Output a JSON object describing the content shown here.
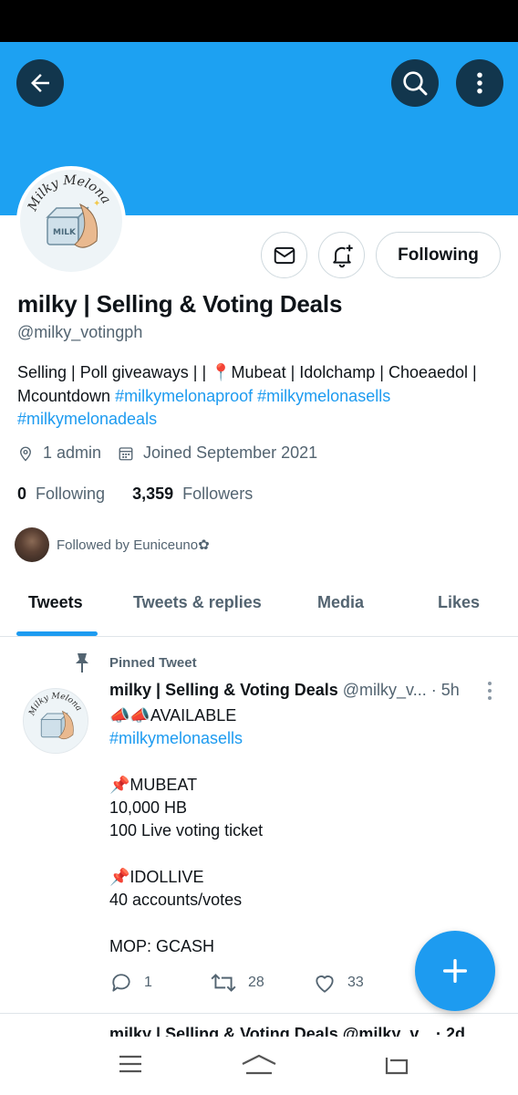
{
  "header": {
    "back_icon": "arrow-left-icon",
    "search_icon": "search-icon",
    "more_icon": "more-vertical-icon",
    "banner_color": "#1da1f2"
  },
  "profile": {
    "avatar_text": "Milky Melona",
    "avatar_sub": "MILK",
    "name": "milky | Selling & Voting Deals",
    "handle": "@milky_votingph",
    "bio_text": "Selling | Poll giveaways | | 📍Mubeat | Idolchamp | Choeaedol | Mcountdown ",
    "bio_tags": [
      "#milkymelonaproof",
      "#milkymelonasells",
      "#milkymelonadeals"
    ],
    "location": "1 admin",
    "joined": "Joined September 2021",
    "following_count": "0",
    "following_label": "Following",
    "followers_count": "3,359",
    "followers_label": "Followers",
    "followed_by": "Followed by Euniceuno✿"
  },
  "actions": {
    "following_button": "Following",
    "mail_icon": "mail-icon",
    "bell_icon": "bell-plus-icon"
  },
  "tabs": [
    {
      "label": "Tweets",
      "active": true
    },
    {
      "label": "Tweets & replies",
      "active": false
    },
    {
      "label": "Media",
      "active": false
    },
    {
      "label": "Likes",
      "active": false
    }
  ],
  "pinned_tweet": {
    "pinned_label": "Pinned Tweet",
    "author_name": "milky | Selling & Voting Deals",
    "author_handle": "@milky_v...",
    "time": "· 5h",
    "lines": [
      "📣📣AVAILABLE",
      "#milkymelonasells",
      "",
      "📌MUBEAT",
      "10,000 HB",
      "100 Live voting ticket",
      "",
      "📌IDOLLIVE",
      "40 accounts/votes",
      "",
      "MOP: GCASH"
    ],
    "reply_count": "1",
    "retweet_count": "28",
    "like_count": "33"
  },
  "next_tweet_peek": "milky | Selling & Voting Deals @milky_v... · 2d",
  "fab_icon": "plus-icon",
  "nav": {
    "recents_icon": "recents-icon",
    "home_icon": "home-icon",
    "back_icon": "nav-back-icon"
  },
  "colors": {
    "accent": "#1d9bf0",
    "text": "#0f1419",
    "muted": "#536471"
  }
}
